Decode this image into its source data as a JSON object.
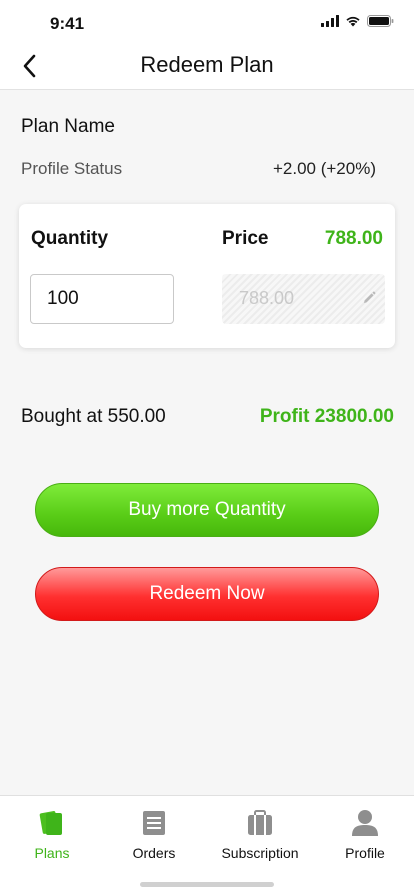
{
  "status_bar": {
    "time": "9:41"
  },
  "header": {
    "title": "Redeem Plan"
  },
  "plan": {
    "name": "Plan Name",
    "status_label": "Profile Status",
    "status_change": "+2.00 (+20%)"
  },
  "trade": {
    "quantity_label": "Quantity",
    "quantity_value": "100",
    "price_label": "Price",
    "price_value": "788.00",
    "price_input_value": "788.00"
  },
  "summary": {
    "bought_at": "Bought at 550.00",
    "profit": "Profit 23800.00"
  },
  "actions": {
    "buy_more": "Buy more Quantity",
    "redeem": "Redeem Now"
  },
  "tabs": [
    {
      "label": "Plans",
      "icon": "plans-icon",
      "active": true
    },
    {
      "label": "Orders",
      "icon": "orders-icon",
      "active": false
    },
    {
      "label": "Subscription",
      "icon": "subscription-icon",
      "active": false
    },
    {
      "label": "Profile",
      "icon": "profile-icon",
      "active": false
    }
  ],
  "colors": {
    "accent_green": "#3fb41a",
    "danger_red": "#ff3030",
    "inactive_icon": "#8e8e8e"
  }
}
